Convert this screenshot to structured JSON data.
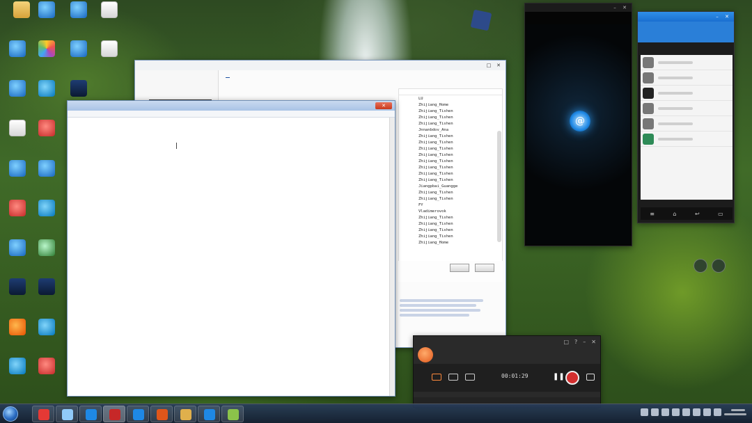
{
  "desktop_icons": [
    {
      "label": "",
      "icon": "folder-icon",
      "color": "#e0b04c"
    },
    {
      "label": "",
      "icon": "app-icon",
      "color": "#1e88e5"
    },
    {
      "label": "",
      "icon": "app-icon",
      "color": "#29b6f6"
    },
    {
      "label": "",
      "icon": "document-icon",
      "color": "#e0e0e0"
    },
    {
      "label": "",
      "icon": "computer-icon",
      "color": "#1565c0"
    },
    {
      "label": "",
      "icon": "app-icon",
      "color": "#ab47bc"
    },
    {
      "label": "",
      "icon": "app-icon",
      "color": "#1e88e5"
    },
    {
      "label": "",
      "icon": "document-icon",
      "color": "#e0e0e0"
    },
    {
      "label": "",
      "icon": "network-icon",
      "color": "#1565c0"
    },
    {
      "label": "",
      "icon": "browser-icon",
      "color": "#0277bd"
    },
    {
      "label": "",
      "icon": "book-icon",
      "color": "#1e3c72"
    },
    {
      "label": "",
      "icon": "recycle-bin-icon",
      "color": "#9e9e9e"
    },
    {
      "label": "",
      "icon": "qq-icon",
      "color": "#c62828"
    },
    {
      "label": "",
      "icon": "cloud-icon",
      "color": "#1e88e5"
    },
    {
      "label": "",
      "icon": "app-icon",
      "color": "#1e88e5"
    },
    {
      "label": "",
      "icon": "qq-icon",
      "color": "#c62828"
    },
    {
      "label": "",
      "icon": "browser-icon",
      "color": "#0277bd"
    },
    {
      "label": "",
      "icon": "star-icon",
      "color": "#1e88e5"
    },
    {
      "label": "",
      "icon": "chat-icon",
      "color": "#2e7d32"
    },
    {
      "label": "",
      "icon": "app-icon",
      "color": "#0b1a33"
    },
    {
      "label": "",
      "icon": "app-icon",
      "color": "#1e3c72"
    },
    {
      "label": "",
      "icon": "app-icon",
      "color": "#e65100"
    },
    {
      "label": "",
      "icon": "browser-icon",
      "color": "#0277bd"
    },
    {
      "label": "",
      "icon": "browser-icon",
      "color": "#0277bd"
    },
    {
      "label": "",
      "icon": "app-icon",
      "color": "#c62828"
    }
  ],
  "chat_window": {
    "title": "",
    "tabs": [
      "",
      ""
    ],
    "log_rows": [
      {
        "name": "LU"
      },
      {
        "name": "Zhijiang_Home"
      },
      {
        "name": "Zhijiang_Tishen"
      },
      {
        "name": "Zhijiang_Tishen"
      },
      {
        "name": "Zhijiang_Tishen"
      },
      {
        "name": "Jnnanbdov_Ana"
      },
      {
        "name": "Zhijiang_Tishen"
      },
      {
        "name": "Zhijiang_Tishen"
      },
      {
        "name": "Zhijiang_Tishen"
      },
      {
        "name": "Zhijiang_Tishen"
      },
      {
        "name": "Zhijiang_Tishen"
      },
      {
        "name": "Zhijiang_Tishen"
      },
      {
        "name": "Zhijiang_Tishen"
      },
      {
        "name": "Zhijiang_Tishen"
      },
      {
        "name": "Jiangpbai_Guangge"
      },
      {
        "name": "Zhijiang_Tishen"
      },
      {
        "name": "Zhijiang_Tishen"
      },
      {
        "name": "FY"
      },
      {
        "name": "Vladimerovok"
      },
      {
        "name": "Zhijiang_Tishen"
      },
      {
        "name": "Zhijiang_Tishen"
      },
      {
        "name": "Zhijiang_Tishen"
      },
      {
        "name": "Zhijiang_Tishen"
      },
      {
        "name": "Zhijiang_Home"
      }
    ]
  },
  "notepad": {
    "title": "",
    "menu": [
      "",
      "",
      "",
      "",
      ""
    ],
    "content": ""
  },
  "recorder": {
    "app_name": "",
    "timer": "00:01:29"
  },
  "phone": {
    "title": ""
  },
  "qq_panel": {
    "title": ""
  },
  "taskbar": {
    "apps": [
      {
        "icon": "media-player-icon",
        "color": "#e53935"
      },
      {
        "icon": "window-icon",
        "color": "#90caf9"
      },
      {
        "icon": "cloud-icon",
        "color": "#1e88e5"
      },
      {
        "icon": "app-icon",
        "color": "#c62828"
      },
      {
        "icon": "browser-icon",
        "color": "#1e88e5"
      },
      {
        "icon": "recorder-icon",
        "color": "#e0561a"
      },
      {
        "icon": "folder-icon",
        "color": "#e0b04c"
      },
      {
        "icon": "app-icon",
        "color": "#1e88e5"
      },
      {
        "icon": "app-icon",
        "color": "#8bc34a"
      }
    ]
  },
  "colors": {
    "accent": "#1a6fd0",
    "record_red": "#d32f2f",
    "recorder_orange": "#e0561a"
  }
}
